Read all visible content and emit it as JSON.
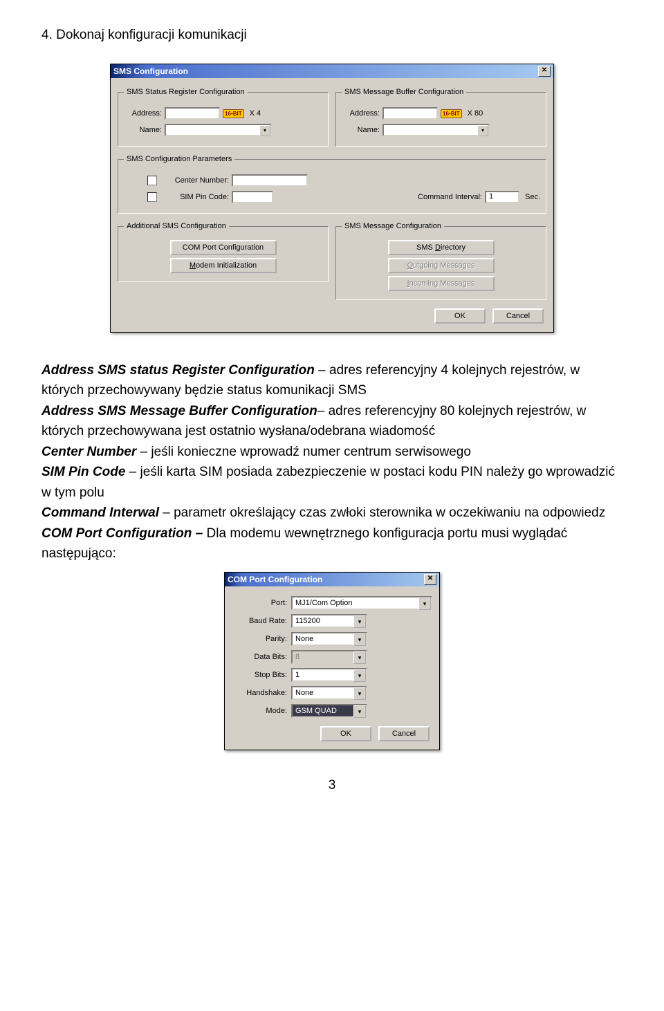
{
  "step_title": "4. Dokonaj konfiguracji komunikacji",
  "dialog1": {
    "title": "SMS Configuration",
    "fs_status": "SMS Status Register Configuration",
    "fs_buffer": "SMS Message Buffer Configuration",
    "label_address": "Address:",
    "label_name": "Name:",
    "bit_tag": "16•BIT",
    "x4": "X 4",
    "x80": "X 80",
    "fs_params": "SMS Configuration Parameters",
    "label_center": "Center Number:",
    "label_pin": "SIM Pin Code:",
    "label_cmd": "Command Interval:",
    "cmd_value": "1",
    "cmd_unit": "Sec.",
    "fs_add": "Additional SMS Configuration",
    "btn_com": "COM Port Configuration",
    "btn_modem": "Modem Initialization",
    "btn_modem_u": "M",
    "fs_msg": "SMS Message Configuration",
    "btn_dir": "SMS Directory",
    "btn_dir_u": "D",
    "btn_out": "Outgoing Messages",
    "btn_out_u": "O",
    "btn_in": "Incoming Messages",
    "btn_in_u": "I",
    "btn_ok": "OK",
    "btn_cancel": "Cancel"
  },
  "para": {
    "t1a": "Address SMS status Register Configuration",
    "t1b": " – adres referencyjny 4 kolejnych rejestrów, w których przechowywany będzie status komunikacji SMS",
    "t2a": "Address SMS Message Buffer Configuration",
    "t2b": "– adres referencyjny 80 kolejnych rejestrów, w których przechowywana jest ostatnio wysłana/odebrana wiadomość",
    "t3a": "Center Number",
    "t3b": " – jeśli konieczne wprowadź numer centrum serwisowego",
    "t4a": "SIM Pin Code",
    "t4b": " – jeśli karta SIM posiada zabezpieczenie w postaci kodu PIN należy go wprowadzić w tym polu",
    "t5a": "Command Interwal",
    "t5b": " – parametr określający czas zwłoki sterownika w oczekiwaniu na odpowiedz",
    "t6a": "COM Port Configuration – ",
    "t6b": "Dla modemu wewnętrznego konfiguracja portu musi wyglądać następująco:"
  },
  "dialog2": {
    "title": "COM Port Configuration",
    "l_port": "Port:",
    "v_port": "MJ1/Com Option",
    "l_baud": "Baud Rate:",
    "v_baud": "115200",
    "l_parity": "Parity:",
    "v_parity": "None",
    "l_databits": "Data Bits:",
    "v_databits": "8",
    "l_stopbits": "Stop Bits:",
    "v_stopbits": "1",
    "l_handshake": "Handshake:",
    "v_handshake": "None",
    "l_mode": "Mode:",
    "v_mode": "GSM QUAD",
    "btn_ok": "OK",
    "btn_cancel": "Cancel"
  },
  "page_number": "3"
}
